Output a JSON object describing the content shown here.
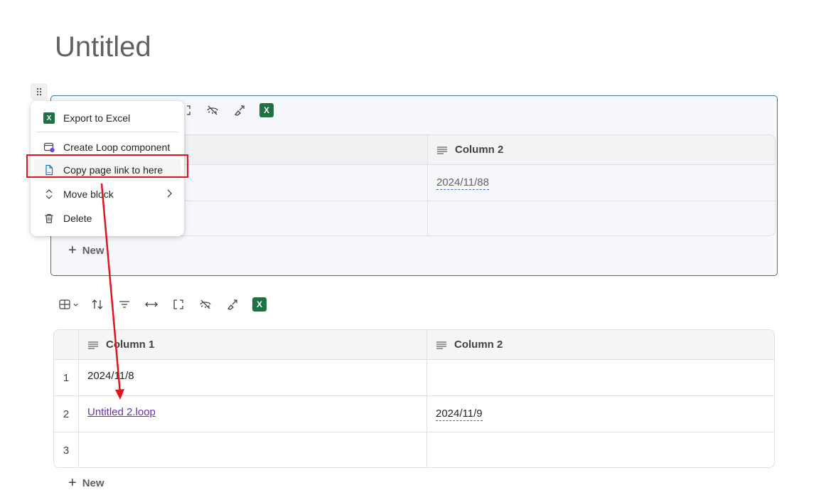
{
  "page": {
    "title": "Untitled"
  },
  "colors": {
    "accent_border": "#3f7590",
    "excel_green": "#1f7244",
    "link_purple": "#6b2fb3",
    "annotation_red": "#e0141e"
  },
  "context_menu": {
    "items": [
      {
        "label": "Export to Excel",
        "icon": "excel-icon"
      },
      {
        "label": "Create Loop component",
        "icon": "loop-component-icon"
      },
      {
        "label": "Copy page link to here",
        "icon": "page-link-icon"
      },
      {
        "label": "Move block",
        "icon": "move-icon",
        "submenu": true
      },
      {
        "label": "Delete",
        "icon": "trash-icon"
      }
    ]
  },
  "table1": {
    "columns": [
      {
        "label": "Column 2"
      }
    ],
    "rows": [
      {
        "col2": "2024/11/88"
      },
      {
        "col2": ""
      }
    ],
    "new_label": "New"
  },
  "table2": {
    "toolbar_icons": [
      "table-view-icon",
      "chevron-down-icon",
      "sort-icon",
      "filter-icon",
      "column-width-icon",
      "resize-icon",
      "hide-icon",
      "paint-icon",
      "excel-icon"
    ],
    "columns": [
      {
        "label": "Column 1"
      },
      {
        "label": "Column 2"
      }
    ],
    "rows": [
      {
        "num": "1",
        "col1": "2024/11/8",
        "col2": ""
      },
      {
        "num": "2",
        "col1": "Untitled 2.loop",
        "col2": "2024/11/9"
      },
      {
        "num": "3",
        "col1": "",
        "col2": ""
      }
    ],
    "new_label": "New"
  }
}
